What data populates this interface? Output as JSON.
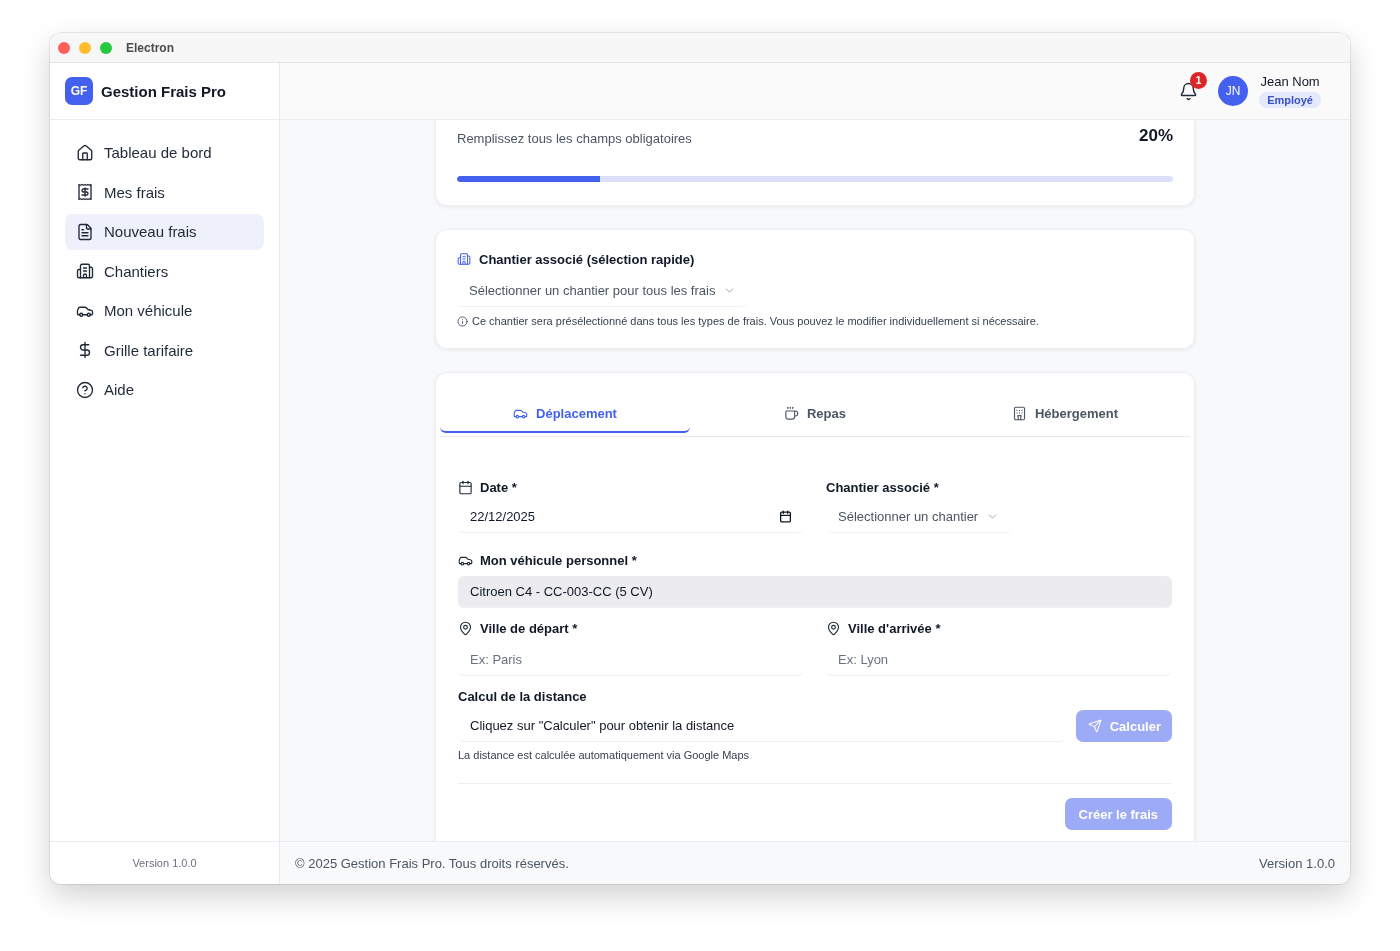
{
  "window": {
    "title": "Electron"
  },
  "sidebar": {
    "logo": {
      "initials": "GF",
      "name": "Gestion Frais Pro"
    },
    "items": [
      {
        "label": "Tableau de bord",
        "selected": false
      },
      {
        "label": "Mes frais",
        "selected": false
      },
      {
        "label": "Nouveau frais",
        "selected": true
      },
      {
        "label": "Chantiers",
        "selected": false
      },
      {
        "label": "Mon véhicule",
        "selected": false
      },
      {
        "label": "Grille tarifaire",
        "selected": false
      },
      {
        "label": "Aide",
        "selected": false
      }
    ],
    "version": "Version 1.0.0"
  },
  "header": {
    "notifications": {
      "count": "1"
    },
    "user": {
      "initials": "JN",
      "name": "Jean Nom",
      "role": "Employé"
    }
  },
  "progress": {
    "subtitle": "Remplissez tous les champs obligatoires",
    "percent": "20%",
    "level": 0.2
  },
  "quick_site": {
    "title": "Chantier associé (sélection rapide)",
    "select": {
      "placeholder": "Sélectionner un chantier pour tous les frais"
    },
    "note": "Ce chantier sera présélectionné dans tous les types de frais. Vous pouvez le modifier individuellement si nécessaire."
  },
  "tabs": [
    {
      "label": "Déplacement",
      "selected": true
    },
    {
      "label": "Repas",
      "selected": false
    },
    {
      "label": "Hébergement",
      "selected": false
    }
  ],
  "form": {
    "date": {
      "label": "Date *",
      "value": "22/12/2025"
    },
    "site": {
      "label": "Chantier associé *",
      "placeholder": "Sélectionner un chantier"
    },
    "vehicle": {
      "label": "Mon véhicule personnel *",
      "value": "Citroen C4 - CC-003-CC (5 CV)"
    },
    "departure": {
      "label": "Ville de départ *",
      "placeholder": "Ex: Paris"
    },
    "arrival": {
      "label": "Ville d'arrivée *",
      "placeholder": "Ex: Lyon"
    },
    "distance": {
      "label": "Calcul de la distance",
      "value": "Cliquez sur \"Calculer\" pour obtenir la distance",
      "calculate_button": {
        "label": "Calculer",
        "disabled": true
      },
      "help": "La distance est calculée automatiquement via Google Maps"
    },
    "submit_button": {
      "label": "Créer le frais",
      "disabled": true
    }
  },
  "footer": {
    "copyright": "© 2025 Gestion Frais Pro. Tous droits réservés.",
    "version": "Version 1.0.0"
  }
}
